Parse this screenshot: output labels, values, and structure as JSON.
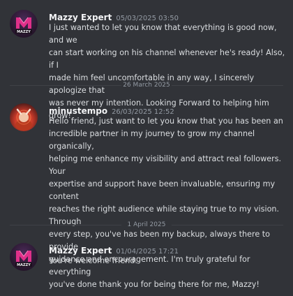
{
  "messages": [
    {
      "username": "Mazzy Expert",
      "timestamp": "05/03/2025 03:50",
      "avatar_logo_text": "MAZZY",
      "text": "I just wanted to let you know that everything is good now, and we\ncan start working on his channel whenever he's ready! Also, if I\nmade him feel uncomfortable in any way, I sincerely apologize that\nwas never my intention. Looking Forward to helping him grow!"
    },
    {
      "username": "minustempo",
      "timestamp": "26/03/2025 12:52",
      "text": "Hello friend, just want to let you know that you has been an\nincredible partner in my journey to grow my channel organically,\nhelping me enhance my visibility and attract real followers. Your\nexpertise and support have been invaluable, ensuring my content\nreaches the right audience while staying true to my vision. Through\nevery step, you've has been my backup, always there to provide\nguidance and encouragement. I'm truly grateful for everything\nyou've done thank you for being there for me, Mazzy!"
    },
    {
      "username": "Mazzy Expert",
      "timestamp": "01/04/2025 17:21",
      "avatar_logo_text": "MAZZY",
      "text": "You're welcome friend."
    }
  ],
  "dividers": [
    {
      "label": "26 March 2025"
    },
    {
      "label": "1 April 2025"
    }
  ],
  "colors": {
    "background": "#313338",
    "username": "#f2f3f5",
    "timestamp": "#949ba4",
    "text": "#dbdee1",
    "divider": "#3f4147",
    "brand_pink": "#e0308a"
  }
}
